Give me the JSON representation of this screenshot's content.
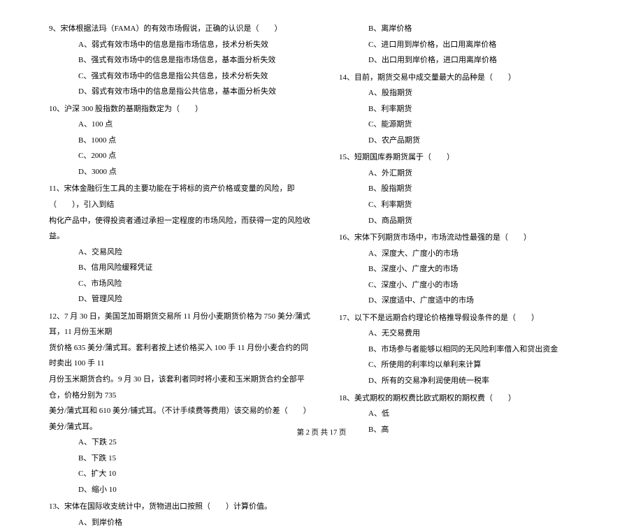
{
  "left": {
    "q9": {
      "text": "9、宋体根据法玛（FAMA）的有效市场假说，正确的认识是（　　）",
      "a": "A、弱式有效市场中的信息是指市场信息，技术分析失效",
      "b": "B、强式有效市场中的信息是指市场信息，基本面分析失效",
      "c": "C、强式有效市场中的信息是指公共信息，技术分析失效",
      "d": "D、弱式有效市场中的信息是指公共信息，基本面分析失效"
    },
    "q10": {
      "text": "10、沪深 300 股指数的基期指数定为（　　）",
      "a": "A、100 点",
      "b": "B、1000 点",
      "c": "C、2000 点",
      "d": "D、3000 点"
    },
    "q11": {
      "text1": "11、宋体金融衍生工具的主要功能在于将标的资产价格或变量的风险，即（　　），引入到结",
      "text2": "构化产品中，使得投资者通过承担一定程度的市场风险，而获得一定的风险收益。",
      "a": "A、交易风险",
      "b": "B、信用风险缓释凭证",
      "c": "C、市场风险",
      "d": "D、管理风险"
    },
    "q12": {
      "text1": "12、7 月 30 日，美国芝加哥期货交易所 11 月份小麦期货价格为 750 美分/蒲式耳，11 月份玉米期",
      "text2": "货价格 635 美分/蒲式耳。套利者按上述价格买入 100 手 11 月份小麦合约的同时卖出 100 手 11",
      "text3": "月份玉米期货合约。9 月 30 日，该套利者同时将小麦和玉米期货合约全部平仓，价格分别为 735",
      "text4": "美分/蒲式耳和 610 美分/铺式耳。（不计手续费等费用）该交易的价差（　　）美分/蒲式耳。",
      "a": "A、下跌 25",
      "b": "B、下跌 15",
      "c": "C、扩大 10",
      "d": "D、缩小 10"
    },
    "q13": {
      "text": "13、宋体在国际收支统计中，货物进出口按照（　　）计算价值。",
      "a": "A、到岸价格"
    }
  },
  "right": {
    "q13cont": {
      "b": "B、离岸价格",
      "c": "C、进口用到岸价格，出口用离岸价格",
      "d": "D、出口用到岸价格，进口用离岸价格"
    },
    "q14": {
      "text": "14、目前，期货交易中成交量最大的品种是（　　）",
      "a": "A、股指期货",
      "b": "B、利率期货",
      "c": "C、能源期货",
      "d": "D、农产品期货"
    },
    "q15": {
      "text": "15、短期国库券期货属于（　　）",
      "a": "A、外汇期货",
      "b": "B、股指期货",
      "c": "C、利率期货",
      "d": "D、商品期货"
    },
    "q16": {
      "text": "16、宋体下列期货市场中，市场流动性最强的是（　　）",
      "a": "A、深度大、广度小的市场",
      "b": "B、深度小、广度大的市场",
      "c": "C、深度小、广度小的市场",
      "d": "D、深度适中、广度适中的市场"
    },
    "q17": {
      "text": "17、以下不是远期合约理论价格推导假设条件的是（　　）",
      "a": "A、无交易费用",
      "b": "B、市场参与者能够以相同的无风险利率借入和贷出资金",
      "c": "C、所使用的利率均以单利来计算",
      "d": "D、所有的交易净利润使用统一税率"
    },
    "q18": {
      "text": "18、美式期权的期权费比欧式期权的期权费（　　）",
      "a": "A、低",
      "b": "B、高"
    }
  },
  "footer": "第 2 页 共 17 页"
}
